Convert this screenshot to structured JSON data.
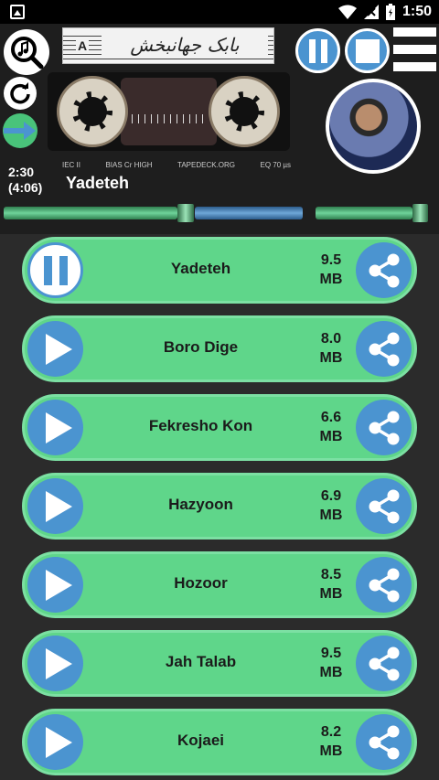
{
  "statusbar": {
    "time": "1:50"
  },
  "header": {
    "side": "A",
    "brand": "بابک جهانبخش"
  },
  "tape_labels": [
    "IEC II",
    "BIAS Cr HIGH",
    "TAPEDECK.ORG",
    "EQ 70 µs"
  ],
  "now_playing": {
    "elapsed": "2:30",
    "duration": "(4:06)",
    "title": "Yadeteh"
  },
  "songs": [
    {
      "title": "Yadeteh",
      "size_value": "9.5",
      "size_unit": "MB",
      "playing": true
    },
    {
      "title": "Boro Dige",
      "size_value": "8.0",
      "size_unit": "MB",
      "playing": false
    },
    {
      "title": "Fekresho Kon",
      "size_value": "6.6",
      "size_unit": "MB",
      "playing": false
    },
    {
      "title": "Hazyoon",
      "size_value": "6.9",
      "size_unit": "MB",
      "playing": false
    },
    {
      "title": "Hozoor",
      "size_value": "8.5",
      "size_unit": "MB",
      "playing": false
    },
    {
      "title": "Jah Talab",
      "size_value": "9.5",
      "size_unit": "MB",
      "playing": false
    },
    {
      "title": "Kojaei",
      "size_value": "8.2",
      "size_unit": "MB",
      "playing": false
    }
  ],
  "icons": {
    "search": "music-search-icon",
    "refresh": "refresh-icon",
    "next": "arrow-right-icon",
    "pause": "pause-icon",
    "stop": "stop-icon",
    "menu": "hamburger-menu-icon",
    "share": "share-icon",
    "play": "play-icon"
  },
  "colors": {
    "accent_green": "#5fd68a",
    "accent_blue": "#4b94d0",
    "background": "#2b2b2b"
  }
}
